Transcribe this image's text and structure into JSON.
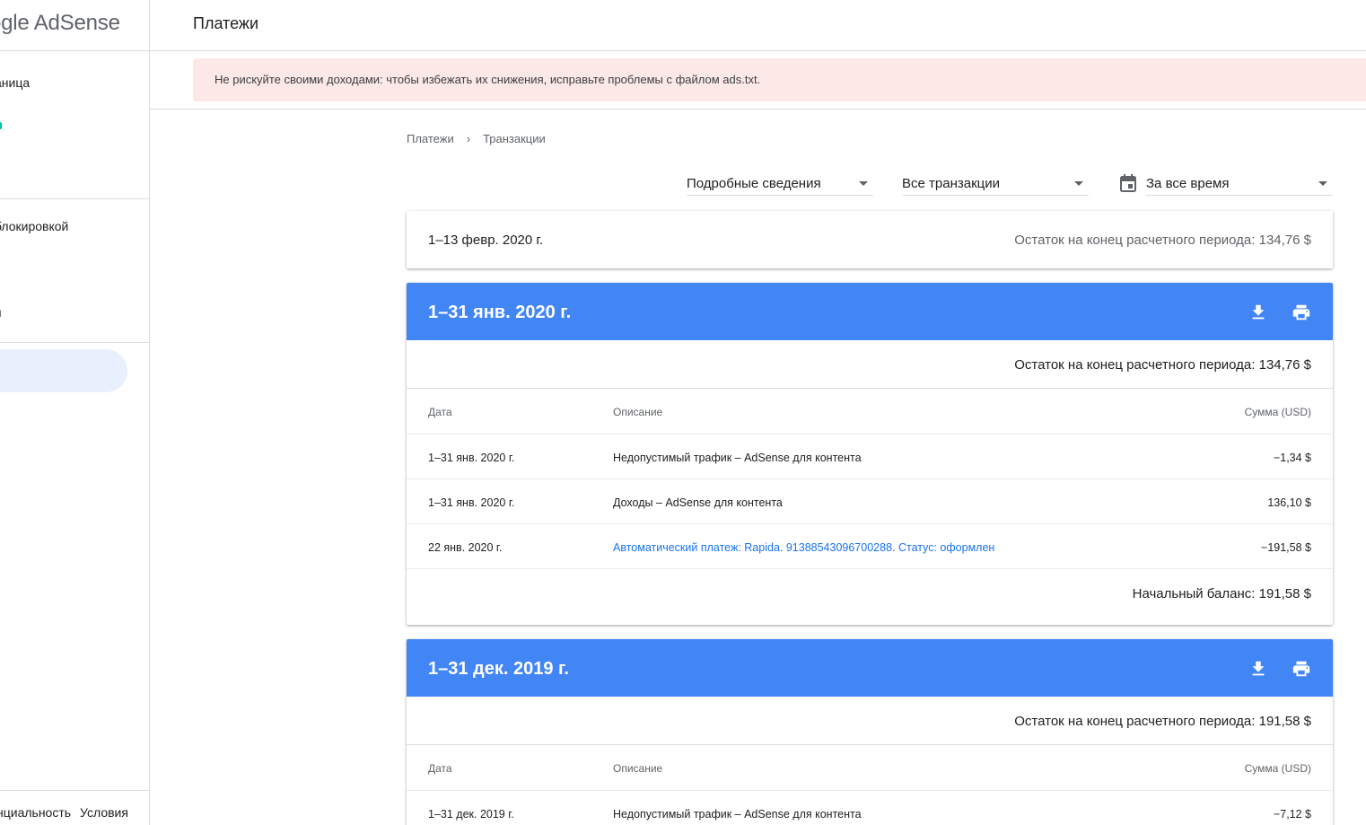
{
  "app": {
    "logo_text": "ogle AdSense",
    "page_title": "Платежи"
  },
  "sidebar": {
    "items": [
      {
        "label": "аница"
      },
      {
        "label": "блокировкой"
      },
      {
        "label": "я"
      }
    ],
    "footer": {
      "privacy": "нциальность",
      "terms": "Условия"
    }
  },
  "alert": {
    "text": "Не рискуйте своими доходами: чтобы избежать их снижения, исправьте проблемы с файлом ads.txt."
  },
  "breadcrumb": {
    "parent": "Платежи",
    "current": "Транзакции"
  },
  "filters": {
    "detail": "Подробные сведения",
    "type": "Все транзакции",
    "period": "За все время"
  },
  "colors": {
    "accent": "#4285f4",
    "alert_bg": "#fce8e6",
    "link": "#1a73e8"
  },
  "icons": {
    "download": "download-icon",
    "print": "print-icon",
    "calendar": "calendar-icon",
    "chevron": "chevron-right-icon"
  },
  "current_period": {
    "period": "1–13 февр. 2020 г.",
    "end_balance": "Остаток на конец расчетного периода: 134,76 $"
  },
  "statements": [
    {
      "title": "1–31 янв. 2020 г.",
      "end_balance": "Остаток на конец расчетного периода: 134,76 $",
      "columns": {
        "date": "Дата",
        "description": "Описание",
        "amount": "Сумма (USD)"
      },
      "rows": [
        {
          "date": "1–31 янв. 2020 г.",
          "description": "Недопустимый трафик – AdSense для контента",
          "amount": "−1,34 $"
        },
        {
          "date": "1–31 янв. 2020 г.",
          "description": "Доходы – AdSense для контента",
          "amount": "136,10 $"
        },
        {
          "date": "22 янв. 2020 г.",
          "description": "Автоматический платеж: Rapida. 91388543096700288. Статус: оформлен",
          "amount": "−191,58 $"
        }
      ],
      "start_balance": "Начальный баланс: 191,58 $"
    },
    {
      "title": "1–31 дек. 2019 г.",
      "end_balance": "Остаток на конец расчетного периода: 191,58 $",
      "columns": {
        "date": "Дата",
        "description": "Описание",
        "amount": "Сумма (USD)"
      },
      "rows": [
        {
          "date": "1–31 дек. 2019 г.",
          "description": "Недопустимый трафик – AdSense для контента",
          "amount": "−7,12 $"
        }
      ]
    }
  ]
}
